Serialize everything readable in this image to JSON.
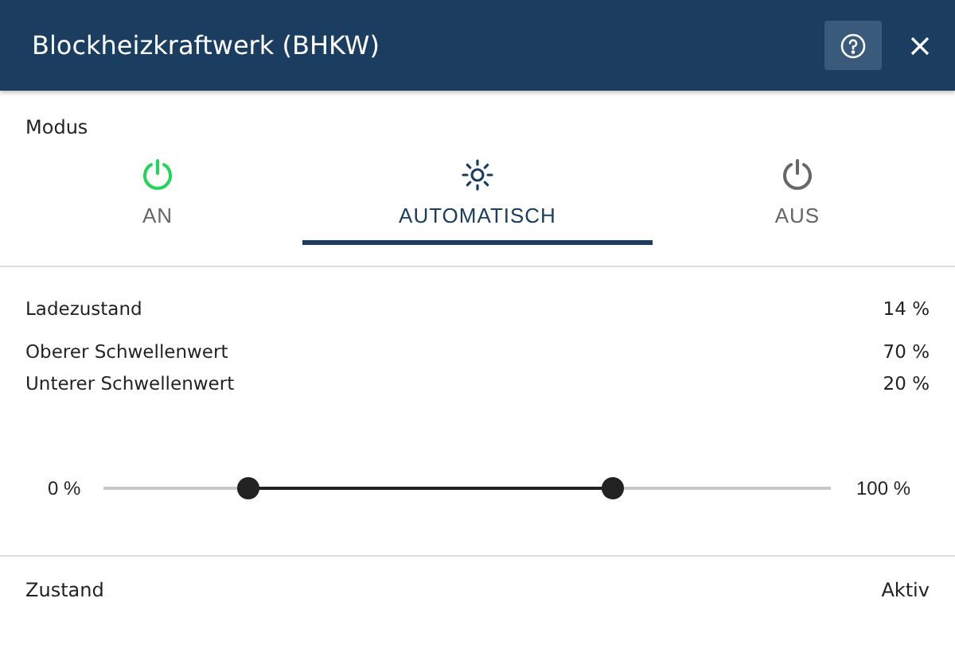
{
  "window": {
    "title": "Blockheizkraftwerk (BHKW)"
  },
  "mode": {
    "label": "Modus",
    "tabs": [
      {
        "label": "AN",
        "kind": "on",
        "selected": false
      },
      {
        "label": "AUTOMATISCH",
        "kind": "auto",
        "selected": true
      },
      {
        "label": "AUS",
        "kind": "off",
        "selected": false
      }
    ]
  },
  "readings": [
    {
      "label": "Ladezustand",
      "value": "14 %"
    },
    {
      "label": "Oberer Schwellenwert",
      "value": "70 %"
    },
    {
      "label": "Unterer Schwellenwert",
      "value": "20 %"
    }
  ],
  "slider": {
    "min_label": "0 %",
    "max_label": "100 %",
    "thumbs": [
      {
        "level": 0.2
      },
      {
        "level": 0.7
      }
    ]
  },
  "status": {
    "label": "Zustand",
    "value": "Aktiv"
  }
}
